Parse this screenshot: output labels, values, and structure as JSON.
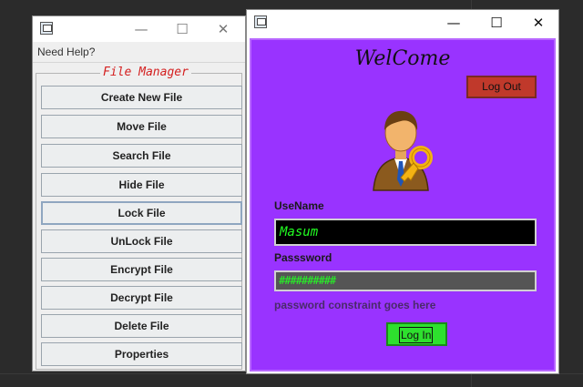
{
  "file_manager": {
    "menu": "Need Help?",
    "group_title": "File Manager",
    "buttons": [
      "Create New File",
      "Move File",
      "Search File",
      "Hide File",
      "Lock File",
      "UnLock File",
      "Encrypt File",
      "Decrypt File",
      "Delete File",
      "Properties"
    ],
    "focused_button": "Lock File"
  },
  "login": {
    "title": "WelCome",
    "logout_label": "Log Out",
    "username_label": "UseName",
    "username_value": "Masum",
    "password_label": "Passsword",
    "password_value": "##########",
    "constraint_text": "password constraint goes here",
    "login_label": "Log In"
  },
  "icons": [
    "app-icon",
    "minimize-icon",
    "maximize-icon",
    "close-icon",
    "user-key-icon"
  ],
  "colors": {
    "panel": "#9933ff",
    "logout": "#c0392b",
    "login": "#2ee02e",
    "input_text": "#22ff22",
    "legend": "#d42020"
  }
}
